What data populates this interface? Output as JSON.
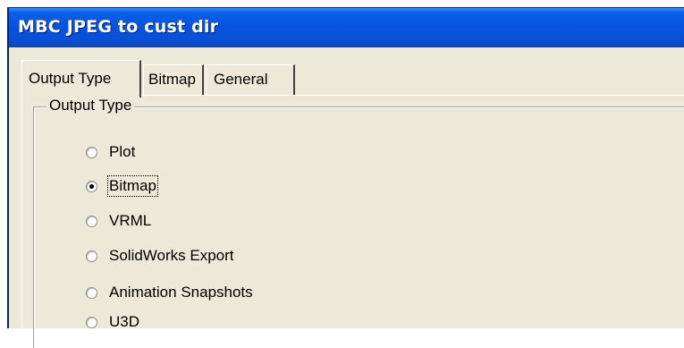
{
  "window": {
    "title": "MBC JPEG to cust dir"
  },
  "tabs": [
    {
      "label": "Output Type",
      "active": true
    },
    {
      "label": "Bitmap",
      "active": false
    },
    {
      "label": "General",
      "active": false
    }
  ],
  "group": {
    "legend": "Output Type"
  },
  "options": [
    {
      "label": "Plot",
      "selected": false
    },
    {
      "label": "Bitmap",
      "selected": true
    },
    {
      "label": "VRML",
      "selected": false
    },
    {
      "label": "SolidWorks Export",
      "selected": false
    },
    {
      "label": "Animation Snapshots",
      "selected": false
    },
    {
      "label": "U3D",
      "selected": false
    }
  ],
  "colors": {
    "titlebar": "#0553df",
    "dialog_bg": "#ece9d8",
    "title_text": "#ffffff"
  }
}
